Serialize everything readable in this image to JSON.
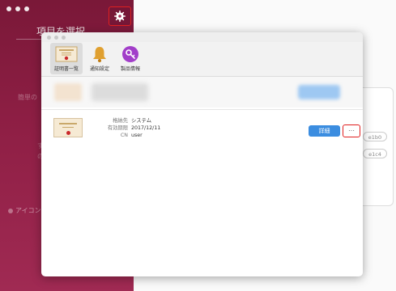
{
  "background_window": {
    "sidebar_title": "項目を選択",
    "sidebar_text_1": "簡単の",
    "sidebar_text_2": "す",
    "sidebar_text_3": "の",
    "icon_option_label": "アイコン",
    "pill_1": "e1b0",
    "pill_2": "e1c4",
    "gear_icon": "gear-icon",
    "sidebar_color": "#8f1f45"
  },
  "dialog": {
    "toolbar": {
      "items": [
        {
          "label": "証明書一覧",
          "icon": "certificate-icon",
          "active": true
        },
        {
          "label": "通知設定",
          "icon": "bell-icon",
          "active": false
        },
        {
          "label": "製品情報",
          "icon": "key-icon",
          "active": false
        }
      ]
    },
    "certificate": {
      "issuer_label": "格納先",
      "issuer": "システム",
      "expiry_label": "有効期限",
      "expiry": "2017/12/11",
      "cn_label": "CN",
      "cn": "user",
      "detail_button": "詳細",
      "more_button": "···"
    },
    "accent_color": "#3b8de0",
    "highlight_color": "#e02020"
  }
}
